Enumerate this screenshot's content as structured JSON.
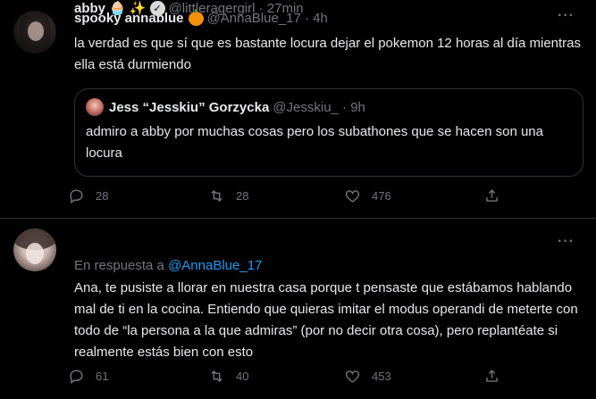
{
  "tweet1": {
    "name": "spooky annablue",
    "handle": "@AnnaBlue_17 · 4h",
    "text": "la verdad es que sí que es bastante locura dejar el pokemon 12 horas al día mientras ella está durmiendo",
    "quote": {
      "name": "Jess “Jesskiu” Gorzycka",
      "handle": "@Jesskiu_ · 9h",
      "text": "admiro a abby por muchas cosas pero los subathones que se hacen son una locura"
    },
    "replies": "28",
    "retweets": "28",
    "likes": "476",
    "more": "···"
  },
  "tweet2": {
    "name": "abby",
    "emojis": "🧁 ✨",
    "verified": "✓",
    "handle": "@littleragergirl · 27min",
    "reply_prefix": "En respuesta a ",
    "reply_to": "@AnnaBlue_17",
    "text": "Ana, te pusiste a llorar en nuestra casa porque t pensaste que estábamos hablando mal de ti en la cocina. Entiendo que quieras imitar el modus operandi de meterte con todo de “la persona a la que admiras” (por no decir otra cosa), pero replantéate si realmente estás bien con esto",
    "replies": "61",
    "retweets": "40",
    "likes": "453",
    "more": "···"
  },
  "colors": {
    "background": "#000000",
    "text": "#e7e9ea",
    "secondary": "#71767b",
    "link": "#1d9bf0",
    "border": "#2f3336"
  }
}
